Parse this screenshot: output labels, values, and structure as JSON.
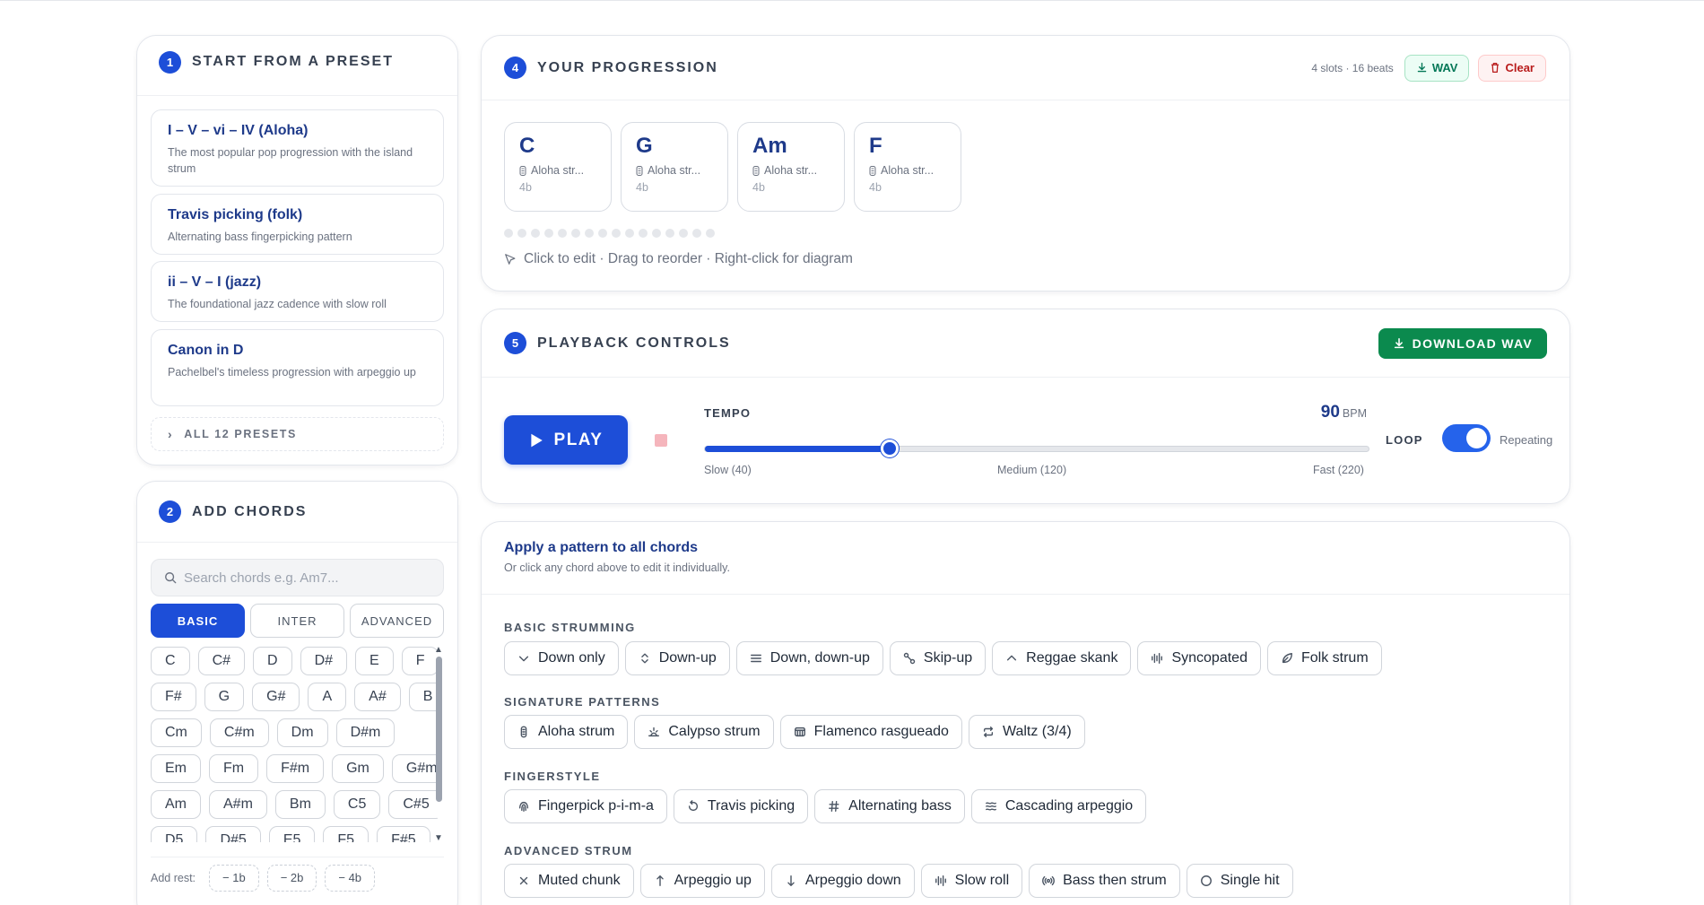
{
  "presets_panel": {
    "step": "1",
    "title": "START FROM A PRESET",
    "presets": [
      {
        "name": "I – V – vi – IV (Aloha)",
        "desc": "The most popular pop progression with the island strum"
      },
      {
        "name": "Travis picking (folk)",
        "desc": "Alternating bass fingerpicking pattern"
      },
      {
        "name": "ii – V – I (jazz)",
        "desc": "The foundational jazz cadence with slow roll"
      },
      {
        "name": "Canon in D",
        "desc": "Pachelbel's timeless progression with arpeggio up"
      }
    ],
    "all_presets_label": "ALL 12 PRESETS"
  },
  "chords_panel": {
    "step": "2",
    "title": "ADD CHORDS",
    "search_placeholder": "Search chords e.g. Am7...",
    "tabs": [
      "BASIC",
      "INTER",
      "ADVANCED"
    ],
    "active_tab": "BASIC",
    "chord_rows": [
      [
        "C",
        "C#",
        "D",
        "D#",
        "E",
        "F"
      ],
      [
        "F#",
        "G",
        "G#",
        "A",
        "A#",
        "B"
      ],
      [
        "Cm",
        "C#m",
        "Dm",
        "D#m"
      ],
      [
        "Em",
        "Fm",
        "F#m",
        "Gm",
        "G#m"
      ],
      [
        "Am",
        "A#m",
        "Bm",
        "C5",
        "C#5"
      ],
      [
        "D5",
        "D#5",
        "E5",
        "F5",
        "F#5"
      ]
    ],
    "rest_label": "Add rest:",
    "rests": [
      "− 1b",
      "− 2b",
      "− 4b"
    ]
  },
  "progression_panel": {
    "step": "4",
    "title": "YOUR PROGRESSION",
    "count": "4 slots · 16 beats",
    "wav_label": "WAV",
    "clear_label": "Clear",
    "slots": [
      {
        "chord": "C",
        "pattern": "Aloha str...",
        "beats": "4b"
      },
      {
        "chord": "G",
        "pattern": "Aloha str...",
        "beats": "4b"
      },
      {
        "chord": "Am",
        "pattern": "Aloha str...",
        "beats": "4b"
      },
      {
        "chord": "F",
        "pattern": "Aloha str...",
        "beats": "4b"
      }
    ],
    "beat_dot_count": 16,
    "hint": "Click to edit · Drag to reorder · Right-click for diagram"
  },
  "playback_panel": {
    "step": "5",
    "title": "PLAYBACK CONTROLS",
    "download_label": "DOWNLOAD WAV",
    "play_label": "PLAY",
    "tempo_label": "TEMPO",
    "tempo_value": "90",
    "tempo_value_num": 90,
    "tempo_min": 40,
    "tempo_max": 220,
    "tempo_unit": "BPM",
    "slow_label": "Slow (40)",
    "medium_label": "Medium (120)",
    "fast_label": "Fast (220)",
    "loop_label": "LOOP",
    "loop_state": "Repeating",
    "loop_on": true
  },
  "patterns_panel": {
    "title": "Apply a pattern to all chords",
    "subtitle": "Or click any chord above to edit it individually.",
    "sections": [
      {
        "name": "BASIC STRUMMING",
        "patterns": [
          {
            "label": "Down only",
            "icon": "chevron-down-icon"
          },
          {
            "label": "Down-up",
            "icon": "chevrons-updown-icon"
          },
          {
            "label": "Down, down-up",
            "icon": "menu-lines-icon"
          },
          {
            "label": "Skip-up",
            "icon": "skip-icon"
          },
          {
            "label": "Reggae skank",
            "icon": "chevron-up-icon"
          },
          {
            "label": "Syncopated",
            "icon": "waveform-icon"
          },
          {
            "label": "Folk strum",
            "icon": "leaf-icon"
          }
        ]
      },
      {
        "name": "SIGNATURE PATTERNS",
        "patterns": [
          {
            "label": "Aloha strum",
            "icon": "guitar-icon"
          },
          {
            "label": "Calypso strum",
            "icon": "sun-horizon-icon"
          },
          {
            "label": "Flamenco rasgueado",
            "icon": "fan-icon"
          },
          {
            "label": "Waltz (3/4)",
            "icon": "repeat-icon"
          }
        ]
      },
      {
        "name": "FINGERSTYLE",
        "patterns": [
          {
            "label": "Fingerpick p-i-m-a",
            "icon": "fingerprint-icon"
          },
          {
            "label": "Travis picking",
            "icon": "rotate-icon"
          },
          {
            "label": "Alternating bass",
            "icon": "hash-icon"
          },
          {
            "label": "Cascading arpeggio",
            "icon": "waves-icon"
          }
        ]
      },
      {
        "name": "ADVANCED STRUM",
        "patterns": [
          {
            "label": "Muted chunk",
            "icon": "x-icon"
          },
          {
            "label": "Arpeggio up",
            "icon": "arrow-up-icon"
          },
          {
            "label": "Arpeggio down",
            "icon": "arrow-down-icon"
          },
          {
            "label": "Slow roll",
            "icon": "waveform-icon"
          },
          {
            "label": "Bass then strum",
            "icon": "radio-icon"
          },
          {
            "label": "Single hit",
            "icon": "circle-icon"
          }
        ]
      }
    ]
  },
  "colors": {
    "primary": "#1d4ed8",
    "download_green": "#0b8a4e",
    "heading_navy": "#1e3a8a"
  }
}
